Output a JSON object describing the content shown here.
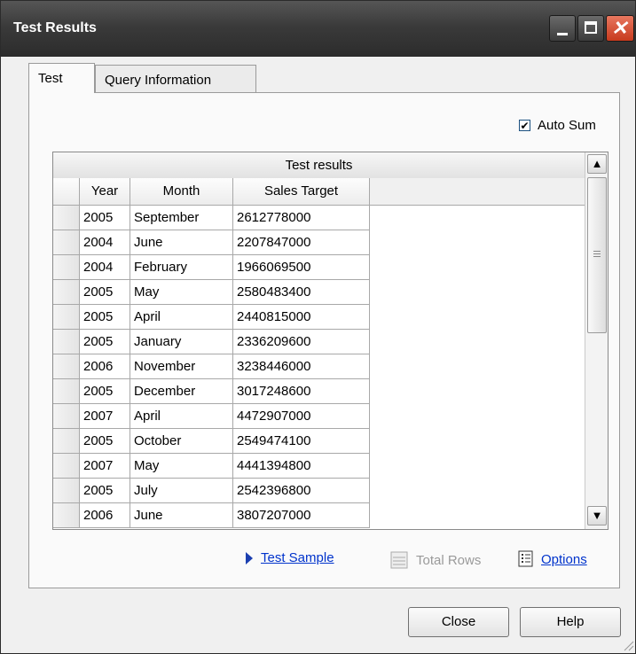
{
  "window": {
    "title": "Test Results"
  },
  "tabs": [
    {
      "label": "Test",
      "active": true
    },
    {
      "label": "Query Information",
      "active": false
    }
  ],
  "auto_sum": {
    "label": "Auto Sum",
    "checked": true
  },
  "grid": {
    "caption": "Test results",
    "columns": [
      "Year",
      "Month",
      "Sales Target"
    ],
    "rows": [
      [
        "2005",
        "September",
        "2612778000"
      ],
      [
        "2004",
        "June",
        "2207847000"
      ],
      [
        "2004",
        "February",
        "1966069500"
      ],
      [
        "2005",
        "May",
        "2580483400"
      ],
      [
        "2005",
        "April",
        "2440815000"
      ],
      [
        "2005",
        "January",
        "2336209600"
      ],
      [
        "2006",
        "November",
        "3238446000"
      ],
      [
        "2005",
        "December",
        "3017248600"
      ],
      [
        "2007",
        "April",
        "4472907000"
      ],
      [
        "2005",
        "October",
        "2549474100"
      ],
      [
        "2007",
        "May",
        "4441394800"
      ],
      [
        "2005",
        "July",
        "2542396800"
      ],
      [
        "2006",
        "June",
        "3807207000"
      ]
    ]
  },
  "actions": {
    "test_sample": "Test Sample",
    "total_rows": "Total Rows",
    "options": "Options"
  },
  "buttons": {
    "close": "Close",
    "help": "Help"
  },
  "icons": {
    "test_sample": "play-arrow-icon",
    "total_rows": "total-rows-icon",
    "options": "options-list-icon"
  },
  "colors": {
    "link": "#0033cc",
    "disabled": "#9a9a9a",
    "titlebar": "#3a3a3a",
    "close_button": "#d44a2b"
  }
}
